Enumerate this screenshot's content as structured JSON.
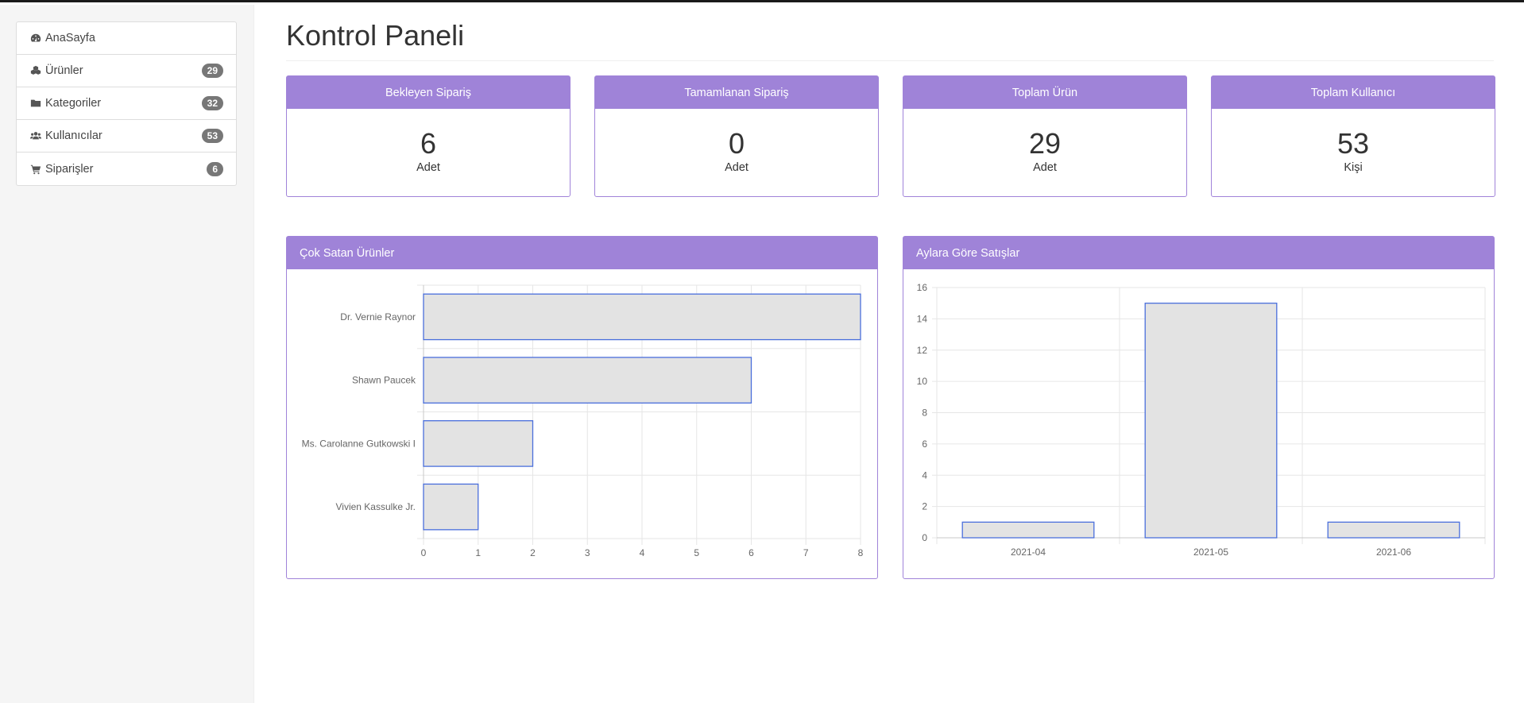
{
  "sidebar": {
    "items": [
      {
        "label": "AnaSayfa",
        "icon": "dashboard-icon",
        "badge": ""
      },
      {
        "label": "Ürünler",
        "icon": "cubes-icon",
        "badge": "29"
      },
      {
        "label": "Kategoriler",
        "icon": "folder-icon",
        "badge": "32"
      },
      {
        "label": "Kullanıcılar",
        "icon": "users-icon",
        "badge": "53"
      },
      {
        "label": "Siparişler",
        "icon": "cart-icon",
        "badge": "6"
      }
    ]
  },
  "page": {
    "title": "Kontrol Paneli"
  },
  "stats": [
    {
      "title": "Bekleyen Sipariş",
      "value": "6",
      "unit": "Adet"
    },
    {
      "title": "Tamamlanan Sipariş",
      "value": "0",
      "unit": "Adet"
    },
    {
      "title": "Toplam Ürün",
      "value": "29",
      "unit": "Adet"
    },
    {
      "title": "Toplam Kullanıcı",
      "value": "53",
      "unit": "Kişi"
    }
  ],
  "charts": {
    "best_sellers_title": "Çok Satan Ürünler",
    "monthly_sales_title": "Aylara Göre Satışlar"
  },
  "colors": {
    "accent": "#9f83d8",
    "bar_fill": "#e3e3e3",
    "bar_stroke": "#4a6fdc"
  },
  "chart_data": [
    {
      "type": "bar",
      "orientation": "horizontal",
      "title": "Çok Satan Ürünler",
      "categories": [
        "Dr. Vernie Raynor",
        "Shawn Paucek",
        "Ms. Carolanne Gutkowski I",
        "Vivien Kassulke Jr."
      ],
      "values": [
        8,
        6,
        2,
        1
      ],
      "xlim": [
        0,
        8
      ],
      "xticks": [
        "0",
        "1",
        "2",
        "3",
        "4",
        "5",
        "6",
        "7",
        "8"
      ],
      "grid": true
    },
    {
      "type": "bar",
      "orientation": "vertical",
      "title": "Aylara Göre Satışlar",
      "categories": [
        "2021-04",
        "2021-05",
        "2021-06"
      ],
      "values": [
        1,
        15,
        1
      ],
      "ylim": [
        0,
        16
      ],
      "yticks": [
        "0",
        "2",
        "4",
        "6",
        "8",
        "10",
        "12",
        "14",
        "16"
      ],
      "grid": true
    }
  ]
}
